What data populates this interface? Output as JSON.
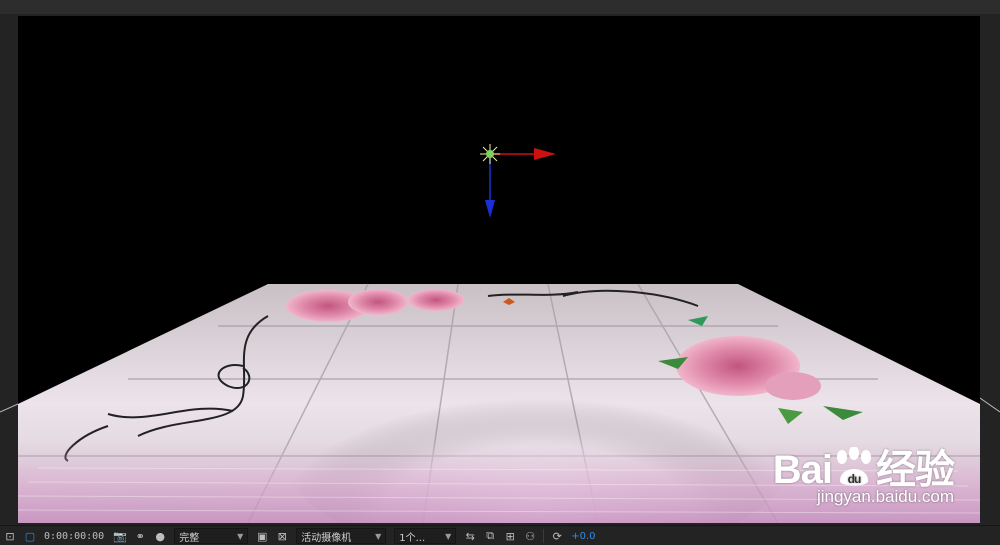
{
  "viewer": {
    "background_color": "#000000",
    "gizmo": {
      "x_axis_color": "#cc1111",
      "y_axis_color": "#1a2fd6",
      "light_center_color": "#7bd35a"
    }
  },
  "watermark": {
    "logo_prefix": "Bai",
    "logo_suffix": "du",
    "logo_cn": "经验",
    "url": "jingyan.baidu.com"
  },
  "toolbar": {
    "timecode": "0:00:00:00",
    "resolution": "完整",
    "camera": "活动摄像机",
    "views": "1个...",
    "exposure": "+0.0",
    "accent_color": "#2d8ceb"
  }
}
